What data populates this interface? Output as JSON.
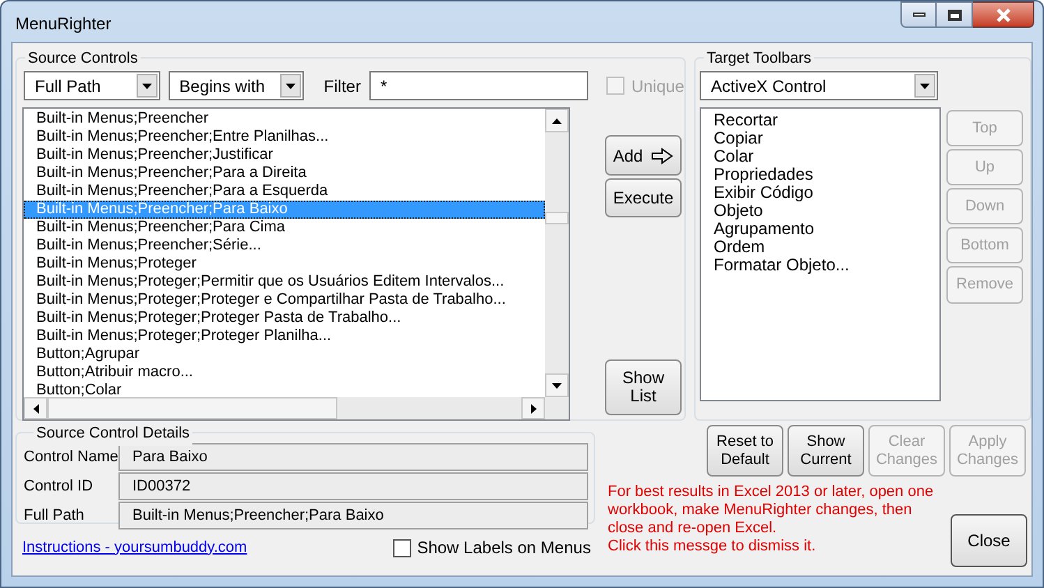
{
  "window": {
    "title": "MenuRighter"
  },
  "source_controls": {
    "title": "Source Controls",
    "mode": "Full Path",
    "match": "Begins with",
    "filter_label": "Filter",
    "filter": "*",
    "unique": {
      "label": "Unique",
      "checked": false,
      "disabled": true
    },
    "items": [
      {
        "label": "Built-in Menus;Preencher",
        "selected": false
      },
      {
        "label": "Built-in Menus;Preencher;Entre Planilhas...",
        "selected": false
      },
      {
        "label": "Built-in Menus;Preencher;Justificar",
        "selected": false
      },
      {
        "label": "Built-in Menus;Preencher;Para a Direita",
        "selected": false
      },
      {
        "label": "Built-in Menus;Preencher;Para a Esquerda",
        "selected": false
      },
      {
        "label": "Built-in Menus;Preencher;Para Baixo",
        "selected": true
      },
      {
        "label": "Built-in Menus;Preencher;Para Cima",
        "selected": false
      },
      {
        "label": "Built-in Menus;Preencher;Série...",
        "selected": false
      },
      {
        "label": "Built-in Menus;Proteger",
        "selected": false
      },
      {
        "label": "Built-in Menus;Proteger;Permitir que os Usuários Editem Intervalos...",
        "selected": false
      },
      {
        "label": "Built-in Menus;Proteger;Proteger e Compartilhar Pasta de Trabalho...",
        "selected": false
      },
      {
        "label": "Built-in Menus;Proteger;Proteger Pasta de Trabalho...",
        "selected": false
      },
      {
        "label": "Built-in Menus;Proteger;Proteger Planilha...",
        "selected": false
      },
      {
        "label": "Button;Agrupar",
        "selected": false
      },
      {
        "label": "Button;Atribuir macro...",
        "selected": false
      },
      {
        "label": "Button;Colar",
        "selected": false
      }
    ],
    "add_button": "Add",
    "execute_button": "Execute",
    "show_list_button": "Show List"
  },
  "target_toolbars": {
    "title": "Target Toolbars",
    "toolbar": "ActiveX Control",
    "items": [
      "Recortar",
      "Copiar",
      "Colar",
      "Propriedades",
      "Exibir Código",
      "Objeto",
      "Agrupamento",
      "Ordem",
      "Formatar Objeto..."
    ],
    "buttons": [
      {
        "label": "Top",
        "disabled": true
      },
      {
        "label": "Up",
        "disabled": true
      },
      {
        "label": "Down",
        "disabled": true
      },
      {
        "label": "Bottom",
        "disabled": true
      },
      {
        "label": "Remove",
        "disabled": true
      }
    ]
  },
  "details": {
    "title": "Source Control Details",
    "fields": [
      {
        "label": "Control Name",
        "value": "Para Baixo"
      },
      {
        "label": "Control ID",
        "value": "ID00372"
      },
      {
        "label": "Full Path",
        "value": "Built-in Menus;Preencher;Para Baixo"
      }
    ]
  },
  "actions": [
    {
      "label": "Reset to Default",
      "disabled": false
    },
    {
      "label": "Show Current",
      "disabled": false
    },
    {
      "label": "Clear Changes",
      "disabled": true
    },
    {
      "label": "Apply Changes",
      "disabled": true
    }
  ],
  "message": [
    "For best results in Excel 2013 or later, open one",
    "workbook, make MenuRighter changes, then",
    "close and re-open Excel.",
    "Click this messge to dismiss it."
  ],
  "instructions_link": "Instructions - yoursumbuddy.com",
  "show_labels": {
    "label": "Show Labels on Menus",
    "checked": false
  },
  "close_button": "Close"
}
